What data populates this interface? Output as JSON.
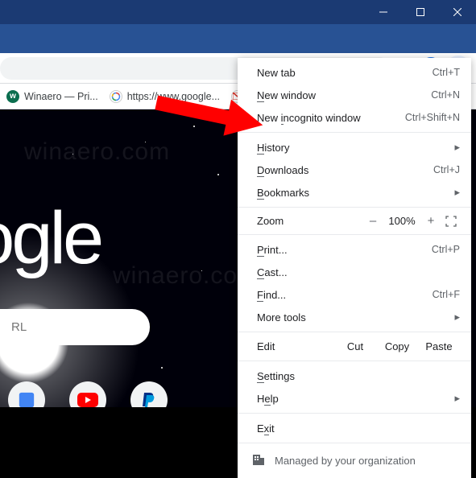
{
  "window": {
    "minimize": "–",
    "maximize": "□",
    "close": "×"
  },
  "omnibox": {
    "star": "☆"
  },
  "bookmarks": {
    "item1_label": "Winaero — Pri...",
    "item2_label": "https://www.google...",
    "item3_label": "Gmail"
  },
  "page": {
    "logo": "oogle",
    "search_placeholder": "RL"
  },
  "menu": {
    "new_tab": "New tab",
    "new_tab_sc": "Ctrl+T",
    "new_window": "New window",
    "new_window_sc": "Ctrl+N",
    "new_incognito": "New incognito window",
    "new_incognito_sc": "Ctrl+Shift+N",
    "history": "History",
    "downloads": "Downloads",
    "downloads_sc": "Ctrl+J",
    "bookmarks": "Bookmarks",
    "zoom_label": "Zoom",
    "zoom_minus": "–",
    "zoom_val": "100%",
    "zoom_plus": "+",
    "print": "Print...",
    "print_sc": "Ctrl+P",
    "cast": "Cast...",
    "find": "Find...",
    "find_sc": "Ctrl+F",
    "more_tools": "More tools",
    "edit": "Edit",
    "cut": "Cut",
    "copy": "Copy",
    "paste": "Paste",
    "settings": "Settings",
    "help": "Help",
    "exit": "Exit",
    "managed": "Managed by your organization"
  }
}
